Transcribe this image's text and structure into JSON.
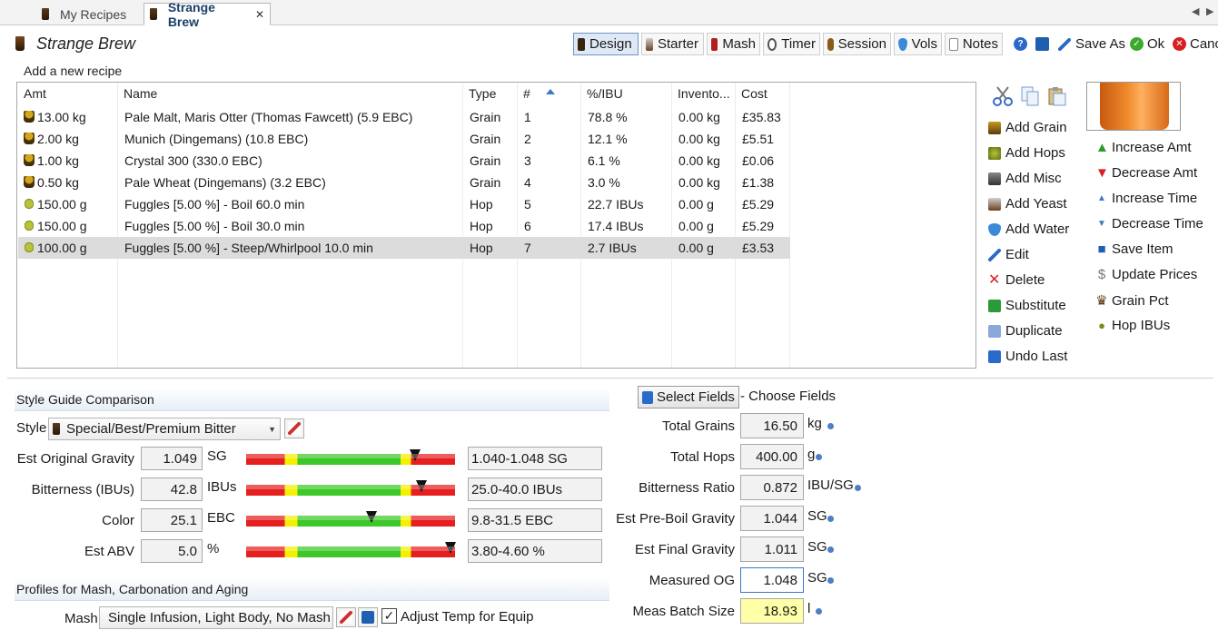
{
  "tabs": [
    {
      "label": "My Recipes"
    },
    {
      "label": "Strange Brew",
      "close": "✕"
    }
  ],
  "app_title": "Strange Brew",
  "toolbar": {
    "items": [
      "Design",
      "Starter",
      "Mash",
      "Timer",
      "Session",
      "Vols",
      "Notes"
    ],
    "save_as": "Save As",
    "ok": "Ok",
    "cancel": "Canc"
  },
  "add_new_recipe": "Add a new recipe",
  "table": {
    "headers": [
      "Amt",
      "Name",
      "Type",
      "#",
      "%/IBU",
      "Invento...",
      "Cost"
    ],
    "rows": [
      {
        "icon": "grain",
        "amt": "13.00 kg",
        "name": "Pale Malt, Maris Otter (Thomas Fawcett) (5.9 EBC)",
        "type": "Grain",
        "num": "1",
        "pct": "78.8 %",
        "inv": "0.00 kg",
        "cost": "£35.83"
      },
      {
        "icon": "grain",
        "amt": "2.00 kg",
        "name": "Munich (Dingemans) (10.8 EBC)",
        "type": "Grain",
        "num": "2",
        "pct": "12.1 %",
        "inv": "0.00 kg",
        "cost": "£5.51"
      },
      {
        "icon": "grain",
        "amt": "1.00 kg",
        "name": "Crystal 300 (330.0 EBC)",
        "type": "Grain",
        "num": "3",
        "pct": "6.1 %",
        "inv": "0.00 kg",
        "cost": "£0.06"
      },
      {
        "icon": "grain",
        "amt": "0.50 kg",
        "name": "Pale Wheat (Dingemans) (3.2 EBC)",
        "type": "Grain",
        "num": "4",
        "pct": "3.0 %",
        "inv": "0.00 kg",
        "cost": "£1.38"
      },
      {
        "icon": "hop",
        "amt": "150.00 g",
        "name": "Fuggles [5.00 %] - Boil 60.0 min",
        "type": "Hop",
        "num": "5",
        "pct": "22.7 IBUs",
        "inv": "0.00 g",
        "cost": "£5.29"
      },
      {
        "icon": "hop",
        "amt": "150.00 g",
        "name": "Fuggles [5.00 %] - Boil 30.0 min",
        "type": "Hop",
        "num": "6",
        "pct": "17.4 IBUs",
        "inv": "0.00 g",
        "cost": "£5.29"
      },
      {
        "icon": "hop",
        "amt": "100.00 g",
        "name": "Fuggles [5.00 %] - Steep/Whirlpool  10.0 min",
        "type": "Hop",
        "num": "7",
        "pct": "2.7 IBUs",
        "inv": "0.00 g",
        "cost": "£3.53"
      }
    ]
  },
  "actions_left": [
    "Add Grain",
    "Add Hops",
    "Add Misc",
    "Add Yeast",
    "Add Water",
    "Edit",
    "Delete",
    "Substitute",
    "Duplicate",
    "Undo Last"
  ],
  "actions_right": [
    "Increase Amt",
    "Decrease Amt",
    "Increase Time",
    "Decrease Time",
    "Save Item",
    "Update Prices",
    "Grain Pct",
    "Hop IBUs"
  ],
  "style_guide": {
    "header": "Style Guide Comparison",
    "style_label": "Style",
    "style_value": "Special/Best/Premium Bitter",
    "rows": [
      {
        "label": "Est Original Gravity",
        "value": "1.049",
        "unit": "SG",
        "range": "1.040-1.048 SG",
        "marker_fraction": 0.81
      },
      {
        "label": "Bitterness (IBUs)",
        "value": "42.8",
        "unit": "IBUs",
        "range": "25.0-40.0 IBUs",
        "marker_fraction": 0.84
      },
      {
        "label": "Color",
        "value": "25.1",
        "unit": "EBC",
        "range": "9.8-31.5 EBC",
        "marker_fraction": 0.6
      },
      {
        "label": "Est ABV",
        "value": "5.0",
        "unit": "%",
        "range": "3.80-4.60 %",
        "marker_fraction": 0.98
      }
    ]
  },
  "profiles": {
    "header": "Profiles for Mash, Carbonation and Aging",
    "mash_label": "Mash",
    "mash_value": "Single Infusion, Light Body, No Mash Out",
    "adjust_temp_label": "Adjust Temp for Equip",
    "adjust_temp_checked": true
  },
  "fields": {
    "select_button": "Select Fields",
    "choose_label": "- Choose Fields",
    "rows": [
      {
        "label": "Total Grains",
        "value": "16.50",
        "unit": "kg",
        "state": "normal"
      },
      {
        "label": "Total Hops",
        "value": "400.00",
        "unit": "g",
        "state": "normal"
      },
      {
        "label": "Bitterness Ratio",
        "value": "0.872",
        "unit": "IBU/SG",
        "state": "normal"
      },
      {
        "label": "Est Pre-Boil Gravity",
        "value": "1.044",
        "unit": "SG",
        "state": "normal"
      },
      {
        "label": "Est Final Gravity",
        "value": "1.011",
        "unit": "SG",
        "state": "normal"
      },
      {
        "label": "Measured OG",
        "value": "1.048",
        "unit": "SG",
        "state": "editing"
      },
      {
        "label": "Meas Batch Size",
        "value": "18.93",
        "unit": "l",
        "state": "highlight"
      }
    ]
  },
  "colors": {
    "accent": "#3a78c8",
    "selected_row": "#dcdcdc",
    "highlight_field": "#ffffa8"
  }
}
